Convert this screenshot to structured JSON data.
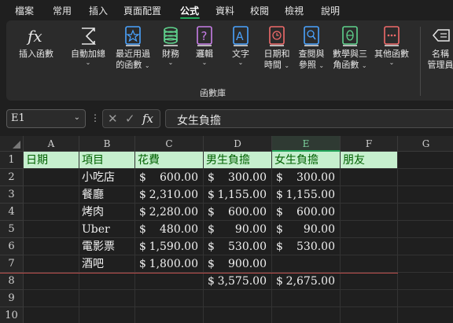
{
  "menu": {
    "tabs": [
      "檔案",
      "常用",
      "插入",
      "頁面配置",
      "公式",
      "資料",
      "校閱",
      "檢視",
      "說明"
    ],
    "active_tab": "公式"
  },
  "ribbon": {
    "buttons": [
      {
        "label1": "插入函數",
        "label2": "",
        "icon": "fx-icon"
      },
      {
        "label1": "自動加總",
        "label2": "",
        "icon": "sigma-icon"
      },
      {
        "label1": "最近用過",
        "label2": "的函數",
        "icon": "star-book-icon"
      },
      {
        "label1": "財務",
        "label2": "",
        "icon": "coins-icon"
      },
      {
        "label1": "邏輯",
        "label2": "",
        "icon": "question-book-icon"
      },
      {
        "label1": "文字",
        "label2": "",
        "icon": "text-book-icon"
      },
      {
        "label1": "日期和",
        "label2": "時間",
        "icon": "clock-book-icon"
      },
      {
        "label1": "查閱與",
        "label2": "參照",
        "icon": "search-book-icon"
      },
      {
        "label1": "數學與三",
        "label2": "角函數",
        "icon": "theta-book-icon"
      },
      {
        "label1": "其他函數",
        "label2": "",
        "icon": "more-book-icon"
      },
      {
        "label1": "名稱",
        "label2": "管理員",
        "icon": "name-tag-icon"
      }
    ],
    "group_label": "函數庫"
  },
  "formula_bar": {
    "name_box": "E1",
    "formula": "女生負擔"
  },
  "sheet": {
    "columns": [
      "A",
      "B",
      "C",
      "D",
      "E",
      "F",
      "G"
    ],
    "rows": [
      "1",
      "2",
      "3",
      "4",
      "5",
      "6",
      "7",
      "8",
      "9",
      "10"
    ],
    "header_row": [
      "日期",
      "項目",
      "花費",
      "男生負擔",
      "女生負擔",
      "朋友"
    ],
    "currency": "$",
    "data": [
      {
        "item": "小吃店",
        "cost": "600.00",
        "male": "300.00",
        "female": "300.00"
      },
      {
        "item": "餐廳",
        "cost": "2,310.00",
        "male": "1,155.00",
        "female": "1,155.00"
      },
      {
        "item": "烤肉",
        "cost": "2,280.00",
        "male": "600.00",
        "female": "600.00"
      },
      {
        "item": "Uber",
        "cost": "480.00",
        "male": "90.00",
        "female": "90.00"
      },
      {
        "item": "電影票",
        "cost": "1,590.00",
        "male": "530.00",
        "female": "530.00"
      },
      {
        "item": "酒吧",
        "cost": "1,800.00",
        "male": "900.00",
        "female": ""
      }
    ],
    "totals": {
      "male": "3,575.00",
      "female": "2,675.00"
    },
    "colors": {
      "header_fill": "#c6efce",
      "header_text": "#006100",
      "accent": "#22a559",
      "line": "#c0504d"
    }
  }
}
